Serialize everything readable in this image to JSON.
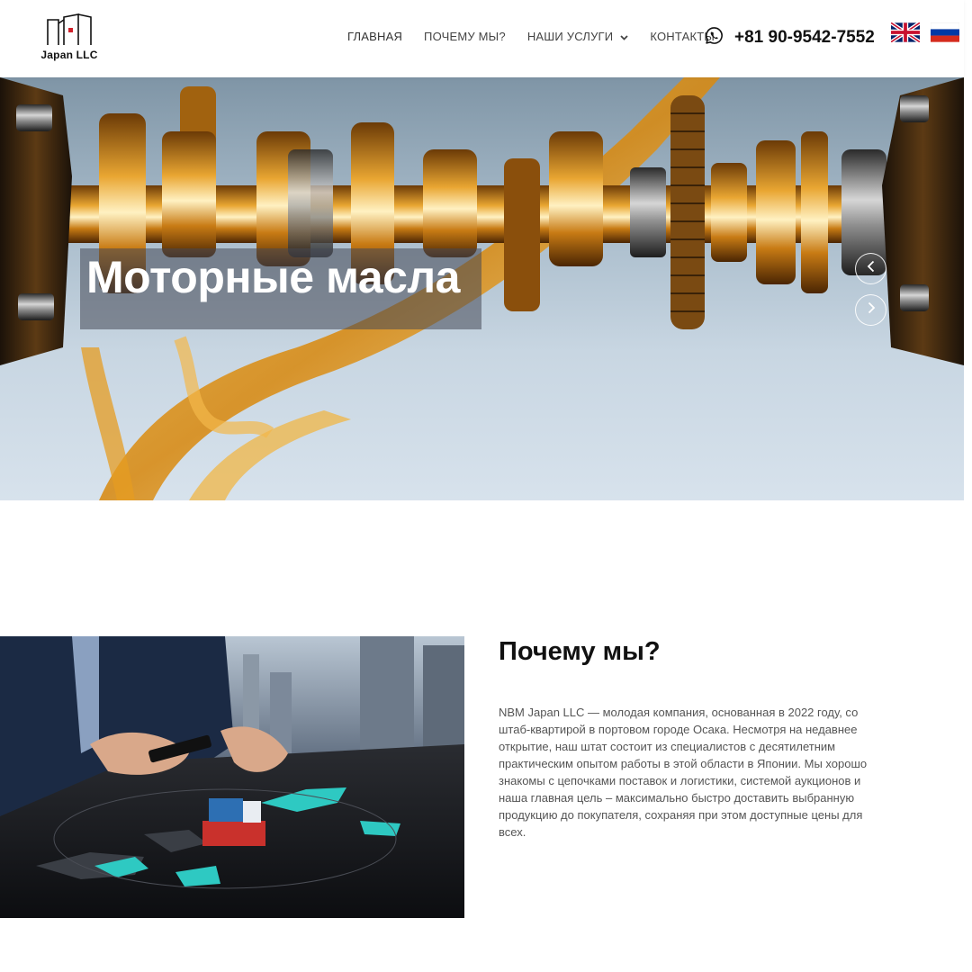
{
  "header": {
    "logo_text": "Japan LLC",
    "nav": [
      {
        "label": "ГЛАВНАЯ"
      },
      {
        "label": "ПОЧЕМУ МЫ?"
      },
      {
        "label": "НАШИ УСЛУГИ",
        "has_dropdown": true
      },
      {
        "label": "КОНТАКТЫ"
      }
    ],
    "phone": "+81 90-9542-7552",
    "phone_icon": "whatsapp-icon",
    "languages": [
      "english-flag-icon",
      "russian-flag-icon"
    ]
  },
  "hero": {
    "title": "Моторные масла",
    "prev_icon": "chevron-left-icon",
    "next_icon": "chevron-right-icon"
  },
  "why": {
    "title": "Почему мы?",
    "text": "NBM Japan LLC — молодая компания, основанная в 2022 году, со штаб-квартирой в портовом городе Осака. Несмотря на недавнее открытие, наш штат состоит из специалистов с десятилетним практическим опытом работы в этой области в Японии. Мы хорошо знакомы с цепочками поставок и логистики, системой аукционов и наша главная цель – максимально быстро доставить выбранную продукцию до покупателя, сохраняя при этом доступные цены для всех."
  },
  "colors": {
    "accent_text": "#111111",
    "nav_text": "#444444",
    "oil_gold": "#d18a1a"
  }
}
